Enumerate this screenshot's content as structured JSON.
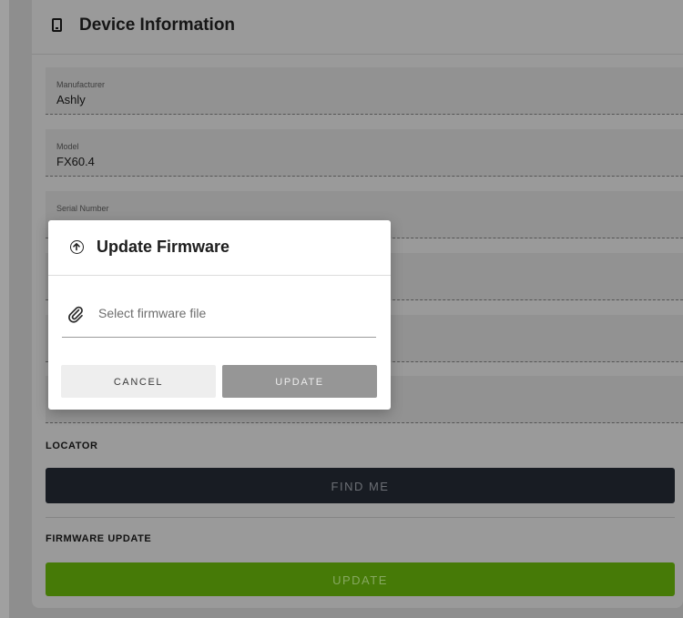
{
  "card": {
    "title": "Device Information"
  },
  "fields": [
    {
      "label": "Manufacturer",
      "value": "Ashly"
    },
    {
      "label": "Model",
      "value": "FX60.4"
    },
    {
      "label": "Serial Number",
      "value": ""
    },
    {
      "label": "",
      "value": ""
    },
    {
      "label": "",
      "value": ""
    },
    {
      "label": "",
      "value": ""
    }
  ],
  "locator": {
    "label": "LOCATOR",
    "button": "FIND ME"
  },
  "firmware": {
    "label": "FIRMWARE UPDATE",
    "button": "UPDATE"
  },
  "dialog": {
    "title": "Update Firmware",
    "file_placeholder": "Select firmware file",
    "cancel": "CANCEL",
    "update": "UPDATE"
  }
}
